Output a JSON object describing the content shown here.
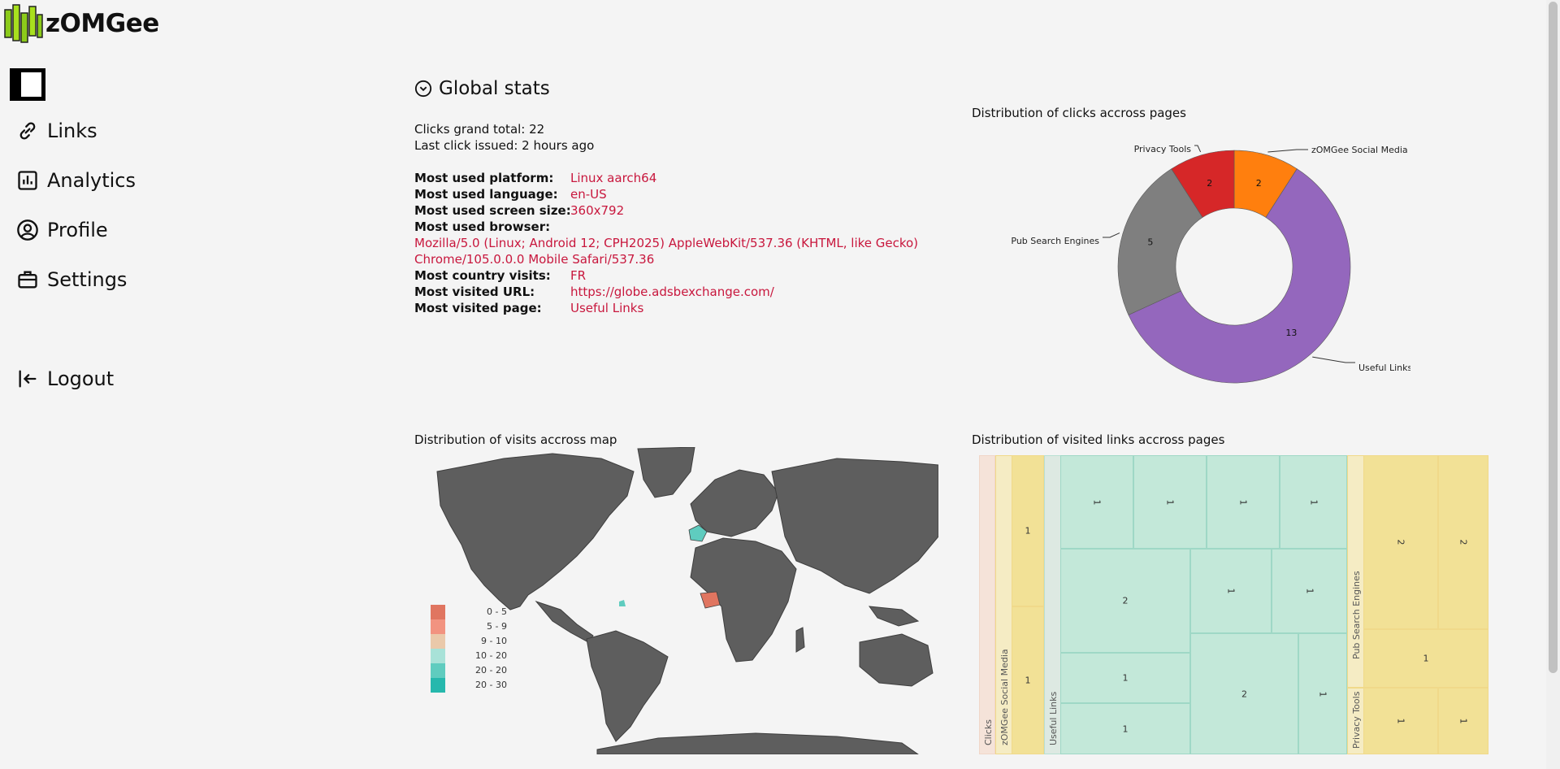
{
  "brand": {
    "name": "zOMGee"
  },
  "sidebar": {
    "items": [
      {
        "label": "Links",
        "icon": "link-icon"
      },
      {
        "label": "Analytics",
        "icon": "analytics-icon"
      },
      {
        "label": "Profile",
        "icon": "profile-icon"
      },
      {
        "label": "Settings",
        "icon": "briefcase-icon"
      }
    ],
    "logout": {
      "label": "Logout",
      "icon": "logout-icon"
    }
  },
  "global_stats": {
    "title": "Global stats",
    "clicks_total": "Clicks grand total: 22",
    "last_click": "Last click issued: 2 hours ago",
    "rows": [
      {
        "key": "Most used platform:",
        "value": "Linux aarch64"
      },
      {
        "key": "Most used language:",
        "value": "en-US"
      },
      {
        "key": "Most used screen size:",
        "value": "360x792"
      },
      {
        "key": "Most used browser:",
        "value": ""
      }
    ],
    "browser_line1": "Mozilla/5.0 (Linux; Android 12; CPH2025) AppleWebKit/537.36 (KHTML, like Gecko)",
    "browser_line2": "Chrome/105.0.0.0 Mobile Safari/537.36",
    "rows2": [
      {
        "key": "Most country visits:",
        "value": "FR"
      },
      {
        "key": "Most visited URL:",
        "value": "https://globe.adsbexchange.com/"
      },
      {
        "key": "Most visited page:",
        "value": "Useful Links"
      }
    ]
  },
  "donut_title": "Distribution of clicks accross pages",
  "map_title": "Distribution of visits accross map",
  "treemap_title": "Distribution of visited links accross pages",
  "map_legend": [
    {
      "label": "0 - 5",
      "color": "#e07560"
    },
    {
      "label": "5 - 9",
      "color": "#f29380"
    },
    {
      "label": "9 - 10",
      "color": "#eac9aa"
    },
    {
      "label": "10 - 20",
      "color": "#a8e2d8"
    },
    {
      "label": "20 - 20",
      "color": "#5fccbf"
    },
    {
      "label": "20 - 30",
      "color": "#26b8ad"
    }
  ],
  "chart_data": [
    {
      "type": "pie",
      "title": "Distribution of clicks accross pages",
      "categories": [
        "zOMGee Social Media",
        "Useful Links",
        "Pub Search Engines",
        "Privacy Tools"
      ],
      "values": [
        2,
        13,
        5,
        2
      ],
      "colors": [
        "#ff7f0e",
        "#9467bd",
        "#7f7f7f",
        "#d62728"
      ]
    },
    {
      "type": "heatmap",
      "title": "Distribution of visited links accross pages",
      "groups": [
        {
          "name": "Clicks",
          "values": []
        },
        {
          "name": "zOMGee Social Media",
          "values": [
            1,
            1
          ]
        },
        {
          "name": "Useful Links",
          "values": [
            1,
            1,
            1,
            1,
            2,
            1,
            1,
            1,
            1,
            2,
            1
          ]
        },
        {
          "name": "Pub Search Engines",
          "values": [
            2,
            2,
            1
          ]
        },
        {
          "name": "Privacy Tools",
          "values": [
            1,
            1
          ]
        }
      ]
    }
  ]
}
